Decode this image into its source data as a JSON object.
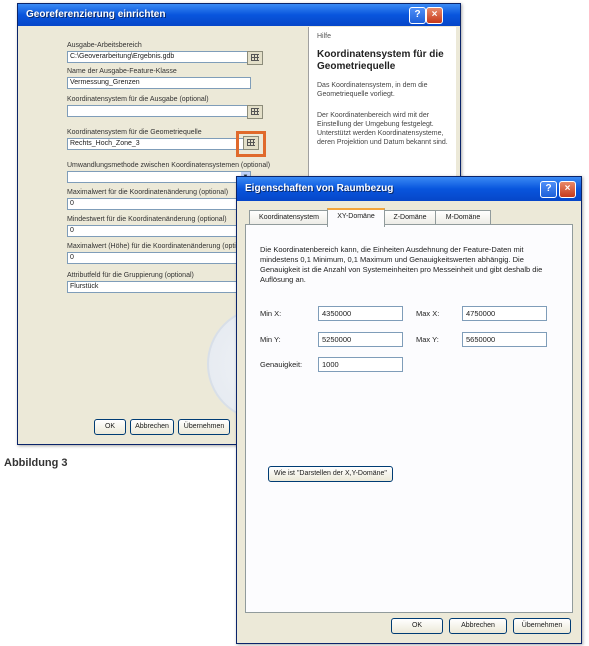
{
  "caption": "Abbildung 3",
  "window1": {
    "title": "Georeferenzierung einrichten",
    "fields": [
      {
        "label": "Ausgabe-Arbeitsbereich",
        "value": "C:\\Geoverarbeitung\\Ergebnis.gdb"
      },
      {
        "label": "Name der Ausgabe-Feature-Klasse",
        "value": "Vermessung_Grenzen"
      },
      {
        "label": "Koordinatensystem für die Ausgabe (optional)",
        "value": ""
      },
      {
        "label": "Koordinatensystem für die Geometriequelle",
        "value": "Rechts_Hoch_Zone_3"
      },
      {
        "label": "Umwandlungsmethode zwischen Koordinatensystemen (optional)",
        "value": ""
      },
      {
        "label": "Maximalwert für die Koordinatenänderung (optional)",
        "value": "0"
      },
      {
        "label": "Mindestwert für die Koordinatenänderung (optional)",
        "value": "0"
      },
      {
        "label": "Maximalwert (Höhe) für die Koordinatenänderung (optional)",
        "value": "0"
      },
      {
        "label": "Attributfeld für die Gruppierung (optional)",
        "value": "Flurstück"
      }
    ],
    "buttons": {
      "ok": "OK",
      "cancel": "Abbrechen",
      "apply": "Übernehmen"
    },
    "help": {
      "top": "Hilfe",
      "title": "Koordinatensystem für die Geometriequelle",
      "p1": "Das Koordinatensystem, in dem die Geometriequelle vorliegt.",
      "p2": "Der Koordinatenbereich wird mit der Einstellung der Umgebung festgelegt. Unterstützt werden Koordinatensysteme, deren Projektion und Datum bekannt sind."
    }
  },
  "window2": {
    "title": "Eigenschaften von Raumbezug",
    "tabs": [
      "Koordinatensystem",
      "XY-Domäne",
      "Z-Domäne",
      "M-Domäne"
    ],
    "active_tab": 1,
    "description": "Die Koordinatenbereich kann, die Einheiten Ausdehnung der Feature-Daten mit mindestens 0,1 Minimum, 0,1 Maximum und Genauigkeitswerten abhängig. Die Genauigkeit ist die Anzahl von Systemeinheiten pro Messeinheit und gibt deshalb die Auflösung an.",
    "fields": {
      "min_x": {
        "label": "Min X:",
        "value": "4350000"
      },
      "max_x": {
        "label": "Max X:",
        "value": "4750000"
      },
      "min_y": {
        "label": "Min Y:",
        "value": "5250000"
      },
      "max_y": {
        "label": "Max Y:",
        "value": "5650000"
      },
      "precision": {
        "label": "Genauigkeit:",
        "value": "1000"
      }
    },
    "link_button": "Wie ist \"Darstellen der X,Y-Domäne\"",
    "buttons": {
      "ok": "OK",
      "cancel": "Abbrechen",
      "apply": "Übernehmen"
    }
  }
}
